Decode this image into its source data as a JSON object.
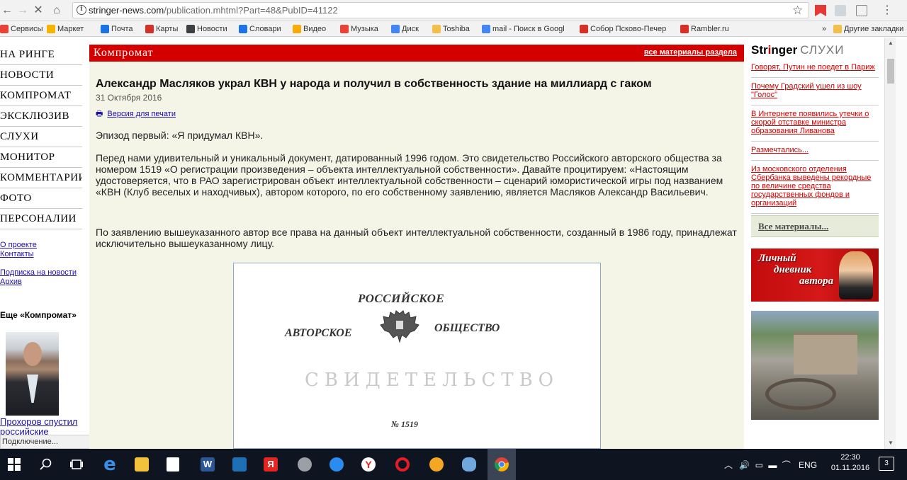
{
  "browser": {
    "url_host": "stringer-news.com",
    "url_path": "/publication.mhtml?Part=48&PubID=41122",
    "bookmarks": [
      {
        "label": "Сервисы",
        "color": "#e94235"
      },
      {
        "label": "Маркет",
        "color": "#f5b400"
      },
      {
        "label": "Почта",
        "color": "#1a73e8"
      },
      {
        "label": "Карты",
        "color": "#d93025"
      },
      {
        "label": "Новости",
        "color": "#3c4043"
      },
      {
        "label": "Словари",
        "color": "#1a73e8"
      },
      {
        "label": "Видео",
        "color": "#f9ab00"
      },
      {
        "label": "Музыка",
        "color": "#ea4335"
      },
      {
        "label": "Диск",
        "color": "#4285f4"
      },
      {
        "label": "Toshiba",
        "color": "#f2c04a"
      },
      {
        "label": "mail - Поиск в Googl",
        "color": "#4285f4"
      },
      {
        "label": "Собор Псково-Печер",
        "color": "#d93025"
      },
      {
        "label": "Rambler.ru",
        "color": "#d93025"
      }
    ],
    "bookmarks_more": "»",
    "other_bookmarks": "Другие закладки"
  },
  "leftnav": {
    "items": [
      "НА РИНГЕ",
      "НОВОСТИ",
      "КОМПРОМАТ",
      "ЭКСКЛЮЗИВ",
      "СЛУХИ",
      "МОНИТОР",
      "КОММЕНТАРИИ",
      "ФОТО",
      "ПЕРСОНАЛИИ"
    ],
    "links": [
      "О проекте",
      "Контакты",
      "Подписка на новости",
      "Архив"
    ],
    "more_title": "Еще «Компромат»",
    "photo_caption": "Прохоров спустил российские",
    "status_text": "Подключение..."
  },
  "main": {
    "section_title": "Компромат",
    "all_section_link": "все материалы раздела",
    "headline": "Александр Масляков украл КВН у народа и получил в собственность здание на миллиард с гаком",
    "date": "31 Октября 2016",
    "print_label": "Версия для печати",
    "paragraphs": [
      "Эпизод первый: «Я придумал КВН».",
      "Перед нами удивительный и уникальный документ, датированный 1996 годом. Это свидетельство Российского авторского общества за номером 1519 «О регистрации произведения – объекта интеллектуальной собственности». Давайте процитируем: «Настоящим удостоверяется, что в РАО зарегистрирован объект интеллектуальной собственности – сценарий юмористической игры под названием «КВН (Клуб веселых и находчивых), автором которого, по его собственному заявлению, является Масляков Александр Васильевич.",
      "По заявлению вышеуказанного автор все права на данный объект интеллектуальной собственности, созданный в 1986 году, принадлежат исключительно вышеуказанному лицу."
    ],
    "doc": {
      "line1": "РОССИЙСКОЕ",
      "line2": "АВТОРСКОЕ",
      "line3": "ОБЩЕСТВО",
      "cert": "СВИДЕТЕЛЬСТВО",
      "number": "№ 1519"
    }
  },
  "right": {
    "brand_a": "Str",
    "brand_r": "i",
    "brand_b": "nger",
    "brand_sub": "СЛУХИ",
    "news": [
      "Говорят, Путин не поедет в Париж",
      "Почему Градский ушел из шоу \"Голос\"",
      "В Интернете появились утечки о скорой отставке министра образования Ливанова",
      "Размечтались...",
      "Из московского отделения Сбербанка выведены рекордные по величине средства государственных фондов и организаций"
    ],
    "all_materials": "Все материалы...",
    "banner_text_1": "Личный",
    "banner_text_2": "дневник",
    "banner_text_3": "автора"
  },
  "taskbar": {
    "lang": "ENG",
    "time": "22:30",
    "date": "01.11.2016",
    "notifications": "3"
  }
}
